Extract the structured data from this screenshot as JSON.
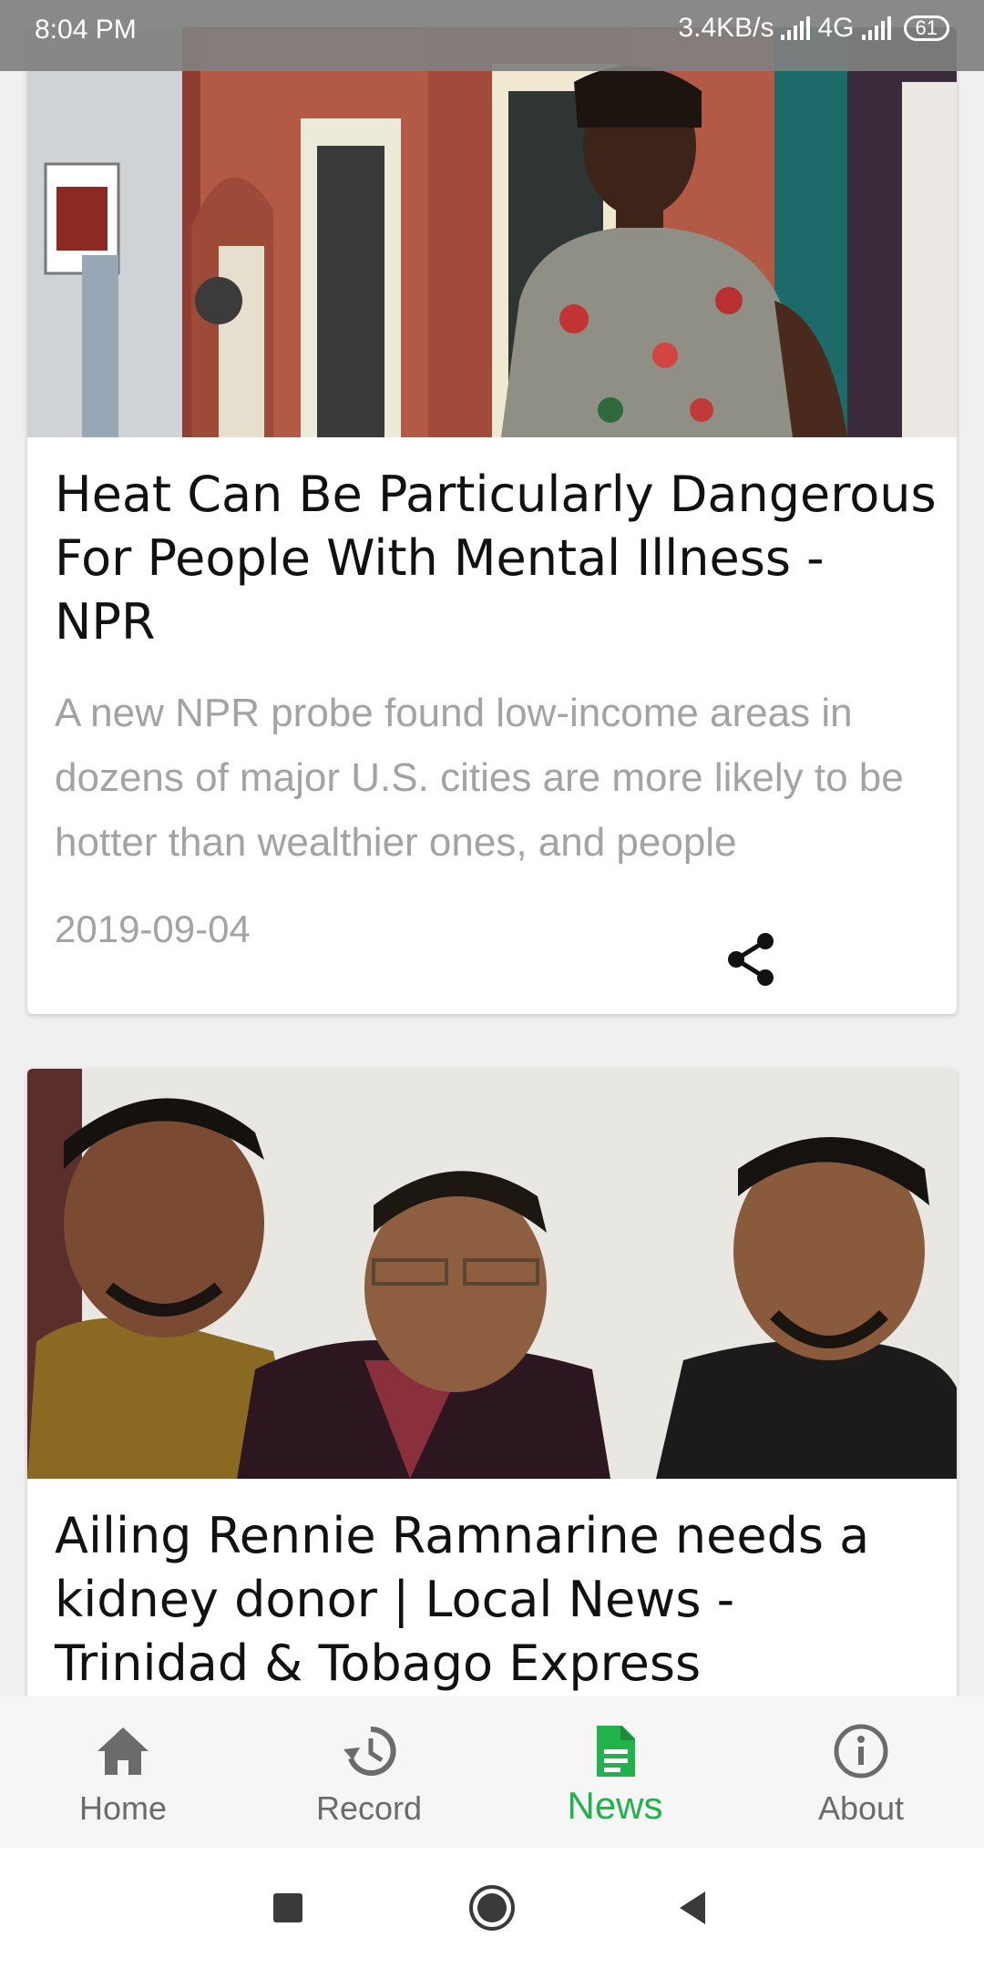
{
  "status_bar": {
    "time": "8:04 PM",
    "network_speed": "3.4KB/s",
    "network_type": "4G",
    "battery": "61"
  },
  "articles": [
    {
      "image": "woman-standing-by-brick-townhouse",
      "title": "Heat Can Be Particularly Dangerous For People With Mental Illness - NPR",
      "summary": "A new NPR probe found low-income areas in dozens of major U.S. cities are more likely to be hotter than wealthier ones, and people",
      "date": "2019-09-04",
      "share_icon": "share-icon"
    },
    {
      "image": "three-men-posing-together",
      "title": "Ailing Rennie Ramnarine needs a kidney donor | Local News - Trinidad & Tobago Express"
    }
  ],
  "bottom_nav": {
    "items": [
      {
        "label": "Home",
        "icon": "home-icon"
      },
      {
        "label": "Record",
        "icon": "history-icon"
      },
      {
        "label": "News",
        "icon": "document-icon"
      },
      {
        "label": "About",
        "icon": "info-icon"
      }
    ],
    "active_color": "#22b24c",
    "inactive_color": "#6b6b6b"
  },
  "system_nav": {
    "recents": "square-icon",
    "home": "circle-icon",
    "back": "triangle-back-icon"
  }
}
